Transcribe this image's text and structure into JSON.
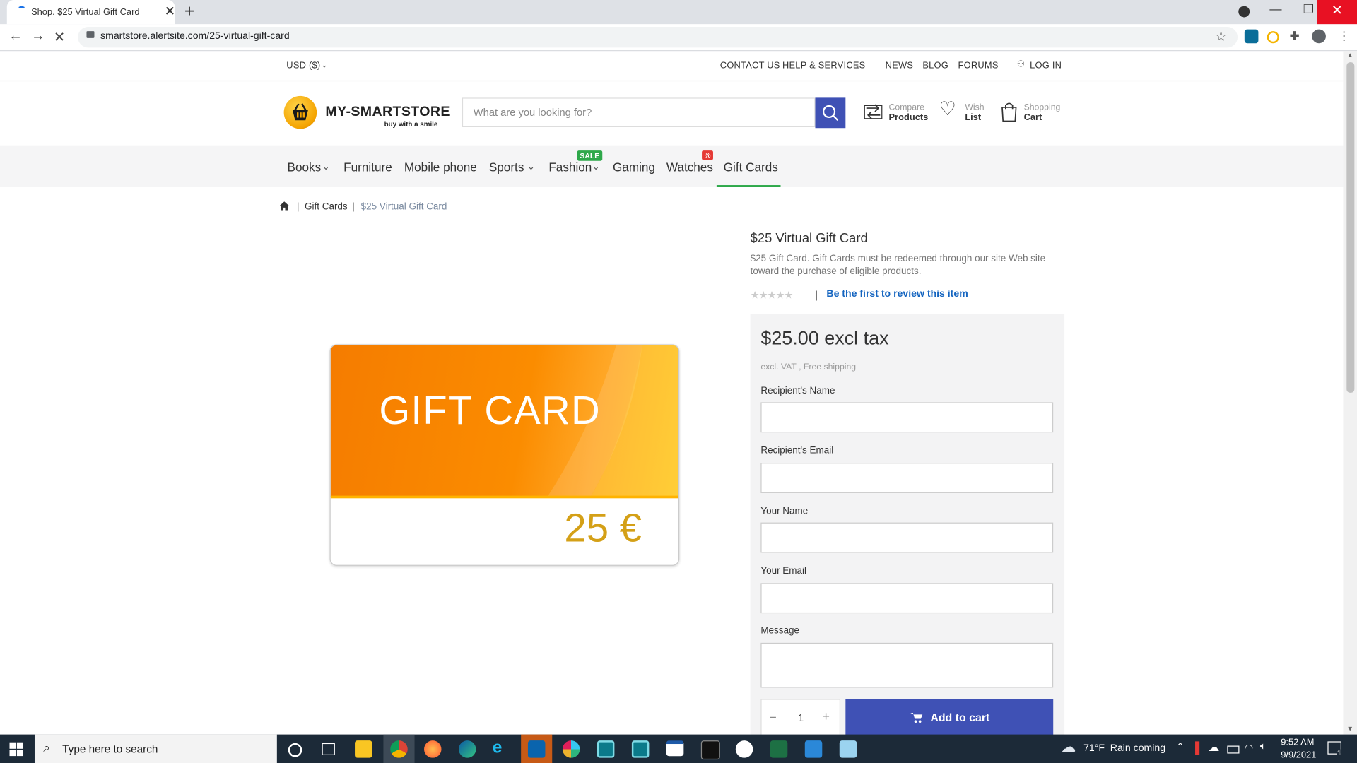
{
  "browser": {
    "tab_title": "Shop. $25 Virtual Gift Card",
    "url": "smartstore.alertsite.com/25-virtual-gift-card"
  },
  "topbar": {
    "currency": "USD ($)",
    "links": [
      "CONTACT US",
      "HELP & SERVICES",
      "NEWS",
      "BLOG",
      "FORUMS",
      "LOG IN"
    ]
  },
  "header": {
    "logo_name": "MY-SMARTSTORE",
    "logo_tagline": "buy with a smile",
    "search_placeholder": "What are you looking for?",
    "compare": {
      "small": "Compare",
      "big": "Products"
    },
    "wishlist": {
      "small": "Wish",
      "big": "List"
    },
    "cart": {
      "small": "Shopping",
      "big": "Cart"
    }
  },
  "nav": {
    "items": [
      "Books",
      "Furniture",
      "Mobile phone",
      "Sports",
      "Fashion",
      "Gaming",
      "Watches",
      "Gift Cards"
    ],
    "badge_sale": "SALE",
    "badge_percent": "%"
  },
  "breadcrumb": {
    "items": [
      "Gift Cards",
      "$25 Virtual Gift Card"
    ]
  },
  "product": {
    "title": "$25 Virtual Gift Card",
    "description": "$25 Gift Card. Gift Cards must be redeemed through our site Web site toward the purchase of eligible products.",
    "stars": "★★★★★",
    "review_link": "Be the first to review this item",
    "price": "$25.00 excl tax",
    "price_note": "excl. VAT , Free shipping",
    "fields": {
      "recipient_name": "Recipient's Name",
      "recipient_email": "Recipient's Email",
      "your_name": "Your Name",
      "your_email": "Your Email",
      "message": "Message"
    },
    "quantity": "1",
    "add_to_cart": "Add to cart",
    "card_title": "GIFT CARD",
    "card_amount": "25 €"
  },
  "taskbar": {
    "search_text": "Type here to search",
    "weather": "71°F  Rain coming",
    "time": "9:52 AM",
    "date": "9/9/2021",
    "notification_count": "1"
  }
}
